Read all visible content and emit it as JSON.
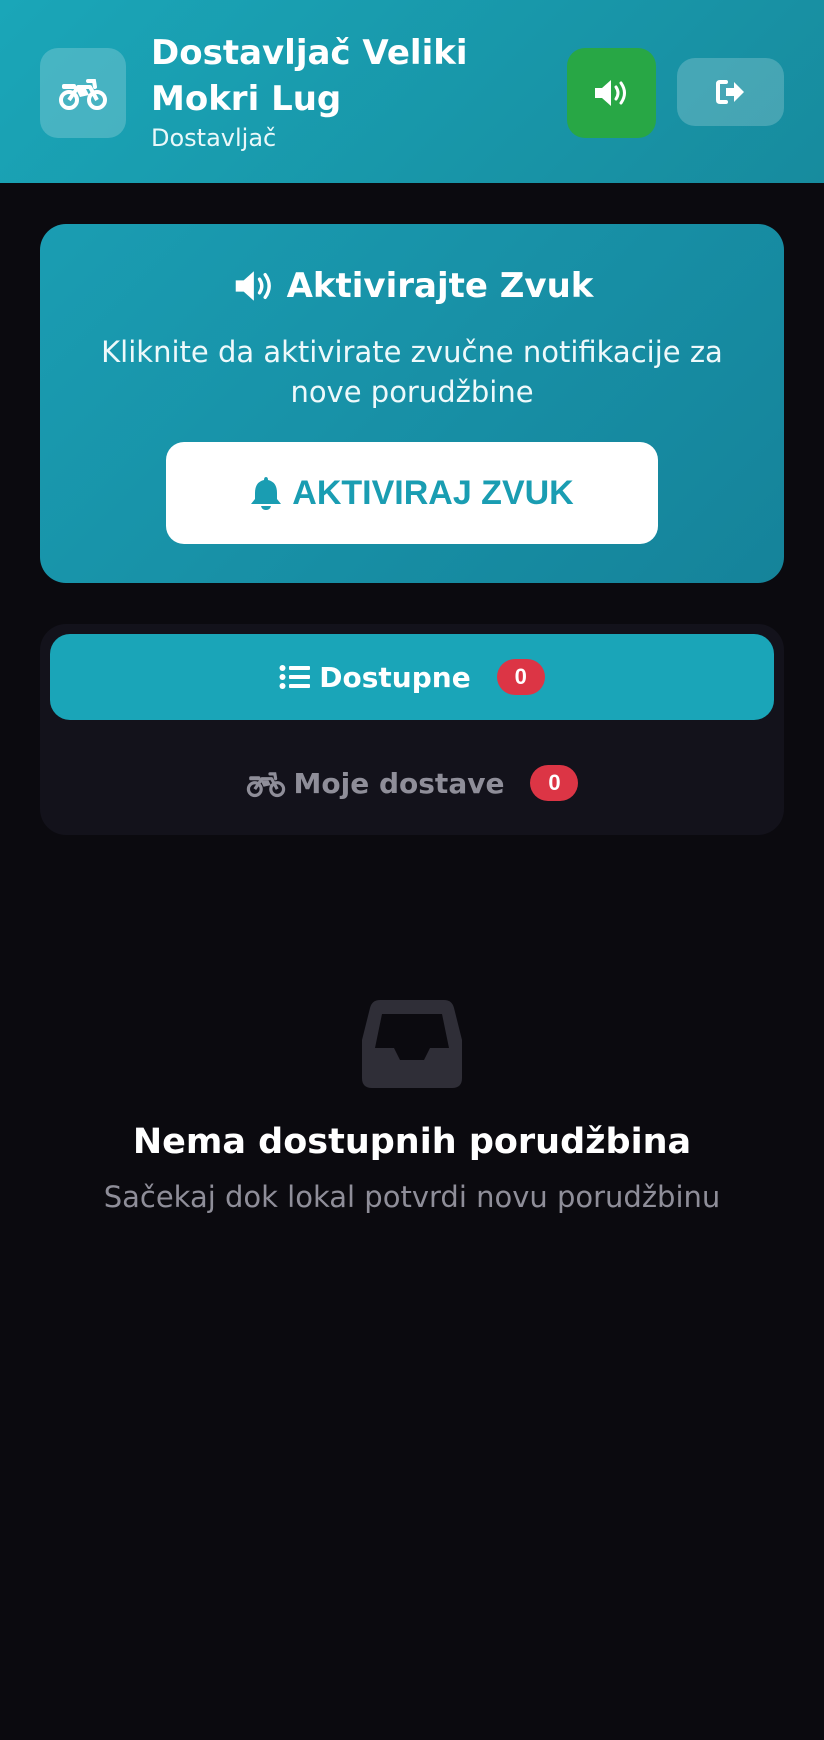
{
  "header": {
    "title": "Dostavljač Veliki Mokri Lug",
    "subtitle": "Dostavljač",
    "logo_icon": "motorcycle-icon",
    "sound_icon": "volume-icon",
    "logout_icon": "sign-out-icon"
  },
  "sound_card": {
    "title": "Aktivirajte Zvuk",
    "description": "Kliknite da aktivirate zvučne notifikacije za nove porudžbine",
    "button_label": "AKTIVIRAJ ZVUK",
    "title_icon": "volume-icon",
    "button_icon": "bell-icon"
  },
  "tabs": [
    {
      "label": "Dostupne",
      "count": "0",
      "icon": "list-icon",
      "active": true
    },
    {
      "label": "Moje dostave",
      "count": "0",
      "icon": "motorcycle-icon",
      "active": false
    }
  ],
  "empty_state": {
    "icon": "inbox-icon",
    "title": "Nema dostupnih porudžbina",
    "subtitle": "Sačekaj dok lokal potvrdi novu porudžbinu"
  },
  "colors": {
    "accent": "#1aa5b8",
    "sound_button": "#28a745",
    "badge": "#dc3545",
    "background": "#0b0a0f"
  }
}
